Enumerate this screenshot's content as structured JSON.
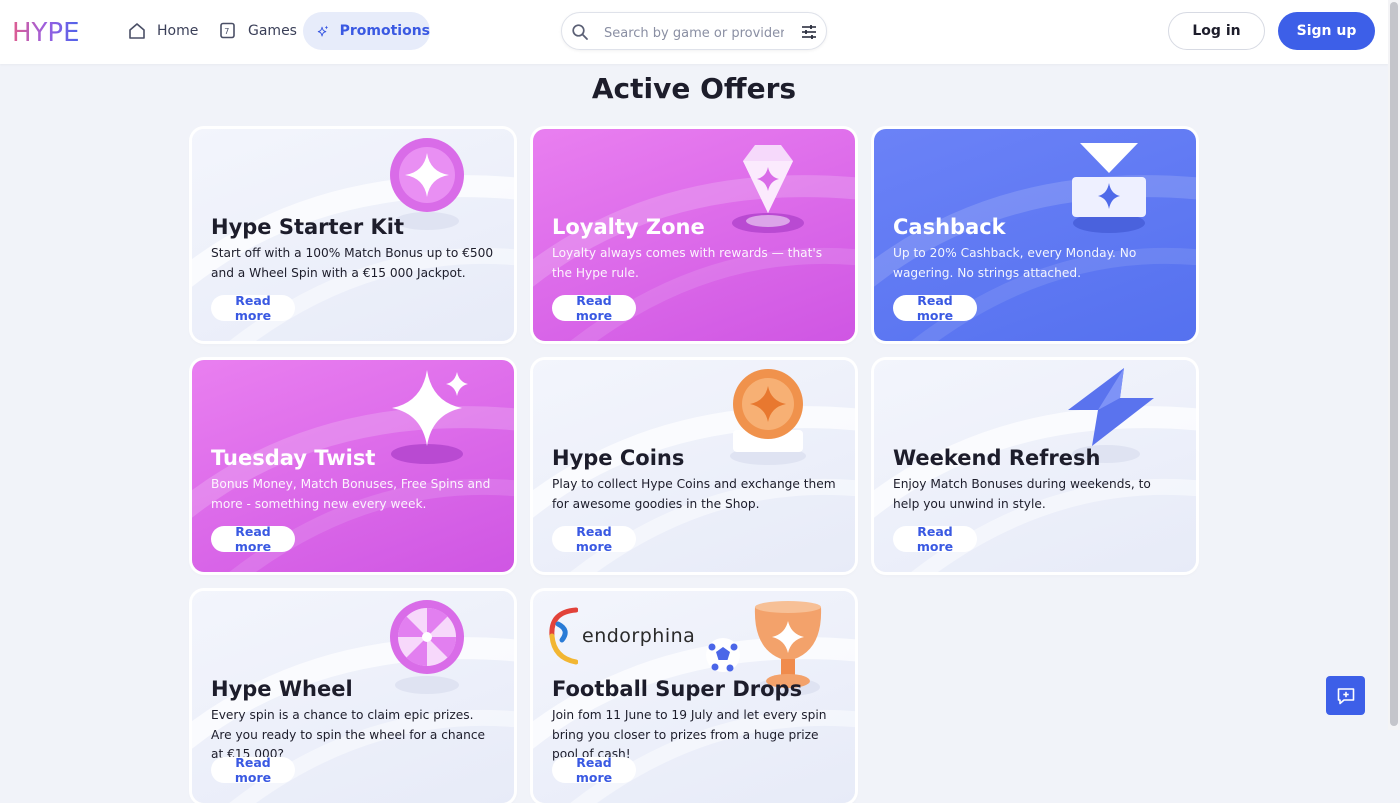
{
  "app": {
    "logo_text": "HYPE",
    "brand_colors": {
      "primary": "#3d5fe8",
      "pink": "#d95ee8",
      "blue": "#5b74f2"
    }
  },
  "nav": {
    "items": [
      {
        "label": "Home",
        "icon": "home-icon",
        "active": false
      },
      {
        "label": "Games",
        "icon": "games-icon",
        "active": false
      },
      {
        "label": "Promotions",
        "icon": "sparkle-icon",
        "active": true
      }
    ]
  },
  "search": {
    "placeholder": "Search by game or provider",
    "value": ""
  },
  "auth": {
    "login_label": "Log in",
    "signup_label": "Sign up"
  },
  "main": {
    "section_title": "Active Offers",
    "read_more_label": "Read more",
    "cards": [
      {
        "title": "Hype Starter Kit",
        "description": "Start off with a 100% Match Bonus up to €500 and a Wheel Spin with a €15 000 Jackpot.",
        "theme": "light",
        "art": "star-orb-icon"
      },
      {
        "title": "Loyalty Zone",
        "description": "Loyalty always comes with rewards — that's the Hype rule.",
        "theme": "pink",
        "art": "diamond-icon"
      },
      {
        "title": "Cashback",
        "description": "Up to 20% Cashback, every Monday. No wagering. No strings attached.",
        "theme": "blue",
        "art": "cashback-ticket-icon"
      },
      {
        "title": "Tuesday Twist",
        "description": "Bonus Money, Match Bonuses, Free Spins and more - something new every week.",
        "theme": "pink",
        "art": "sparkle-stars-icon"
      },
      {
        "title": "Hype Coins",
        "description": "Play to collect Hype Coins and exchange them for awesome goodies in the Shop.",
        "theme": "light",
        "art": "coin-icon"
      },
      {
        "title": "Weekend Refresh",
        "description": "Enjoy Match Bonuses during weekends, to help you unwind in style.",
        "theme": "light",
        "art": "lightning-icon"
      },
      {
        "title": "Hype Wheel",
        "description": "Every spin is a chance to claim epic prizes. Are you ready to spin the wheel for a chance at €15 000?",
        "theme": "light",
        "art": "wheel-icon"
      },
      {
        "title": "Football Super Drops",
        "description": "Join fom 11 June to 19 July and let every spin bring you closer to prizes from a huge prize pool of cash!",
        "theme": "light",
        "art": "trophy-icon",
        "provider": "endorphina"
      }
    ]
  },
  "chat": {
    "icon": "chat-icon"
  }
}
